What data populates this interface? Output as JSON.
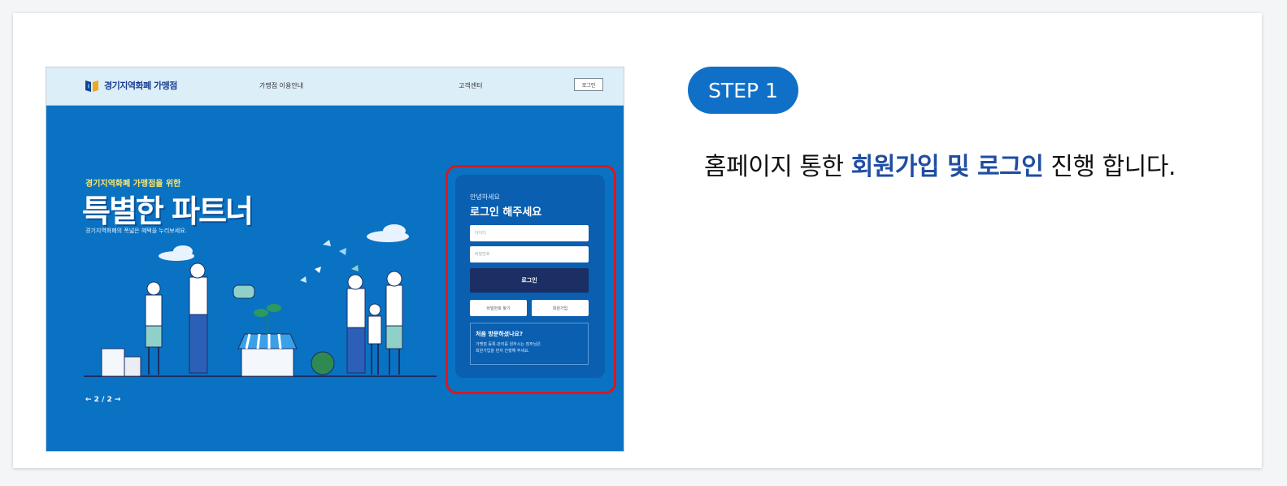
{
  "screenshot": {
    "logo_text": "경기지역화폐 가맹점",
    "nav": [
      "가맹점 이용안내",
      "고객센터"
    ],
    "login_button_small": "로그인",
    "hero": {
      "subtitle": "경기지역화폐 가맹점을 위한",
      "title": "특별한 파트너",
      "description": "경기지역화폐의 폭넓은 혜택을 누리보세요.",
      "pager": "← 2 / 2 →"
    },
    "login_panel": {
      "greeting": "안녕하세요",
      "title": "로그인 해주세요",
      "id_placeholder": "아이디",
      "pw_placeholder": "비밀번호",
      "login_button": "로그인",
      "find_password": "비밀번호 찾기",
      "join": "회원가입",
      "info_title": "처음 방문하셨나요?",
      "info_desc_1": "가맹점 등록·관리를 원하시는 점주님은",
      "info_desc_2": "회원가입을 먼저 진행해 주세요."
    },
    "colors": {
      "hero_bg": "#0a72c2",
      "highlight_outline": "#d8191f",
      "login_button_bg": "#1b2f64"
    }
  },
  "step": {
    "badge": "STEP 1",
    "desc_prefix": "홈페이지 통한 ",
    "desc_highlight": "회원가입 및 로그인",
    "desc_suffix": " 진행 합니다.",
    "badge_color": "#1070c8",
    "highlight_color": "#1f4ea3"
  }
}
